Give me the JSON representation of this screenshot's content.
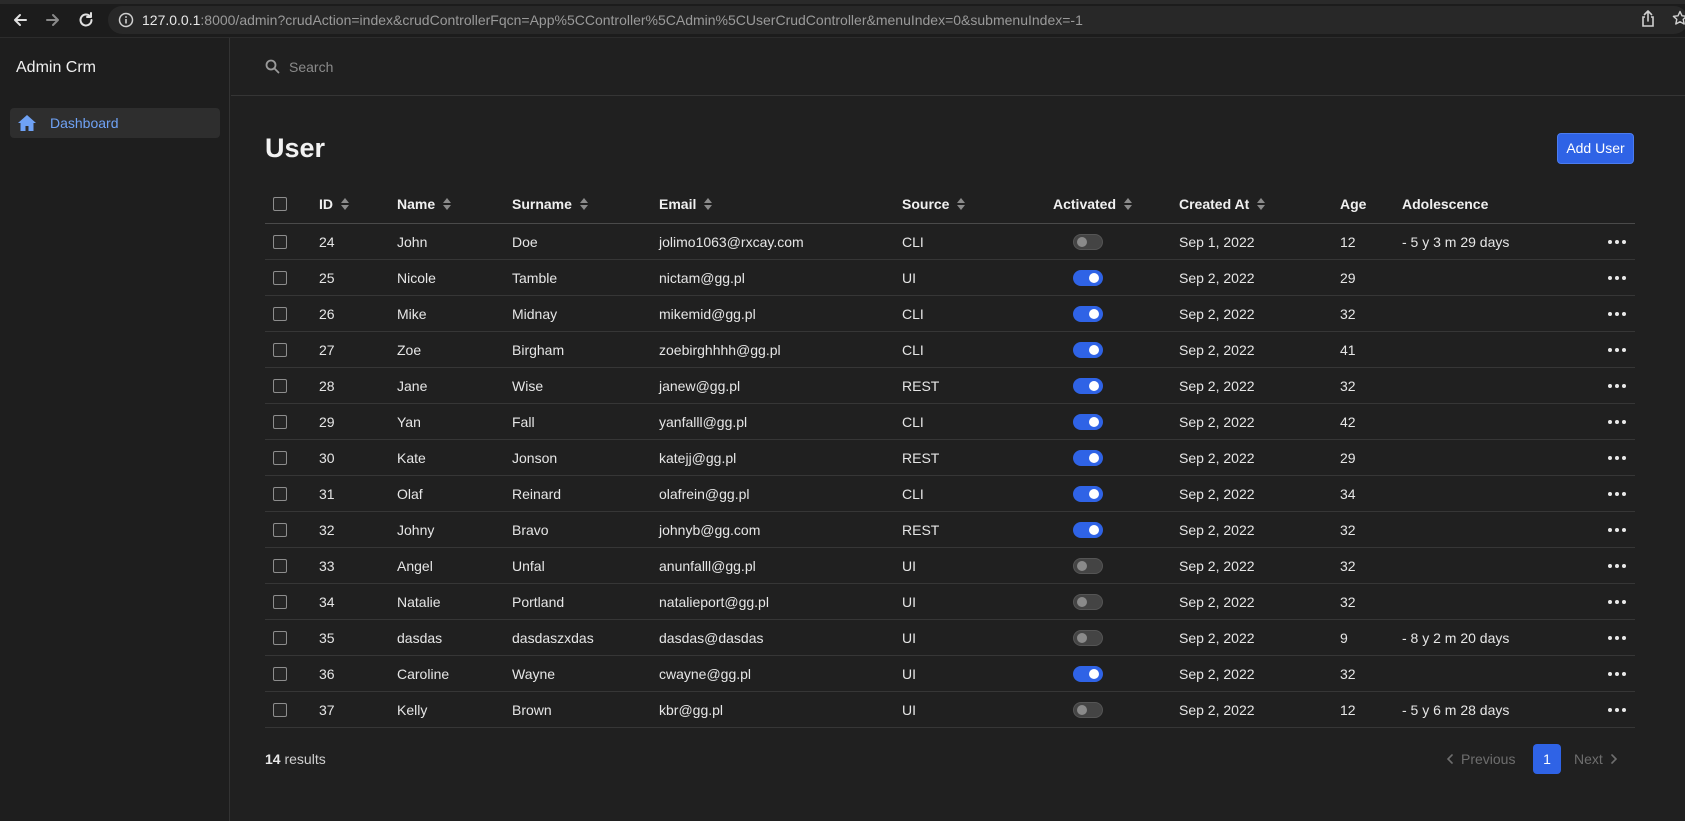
{
  "browser": {
    "url_host": "127.0.0.1",
    "url_rest": ":8000/admin?crudAction=index&crudControllerFqcn=App%5CController%5CAdmin%5CUserCrudController&menuIndex=0&submenuIndex=-1"
  },
  "sidebar": {
    "app_title": "Admin Crm",
    "items": [
      {
        "label": "Dashboard",
        "icon": "home-icon"
      }
    ]
  },
  "search": {
    "placeholder": "Search"
  },
  "page": {
    "title": "User",
    "add_button": "Add User"
  },
  "table": {
    "headers": {
      "id": "ID",
      "name": "Name",
      "surname": "Surname",
      "email": "Email",
      "source": "Source",
      "activated": "Activated",
      "created_at": "Created At",
      "age": "Age",
      "adolescence": "Adolescence"
    },
    "rows": [
      {
        "id": "24",
        "name": "John",
        "surname": "Doe",
        "email": "jolimo1063@rxcay.com",
        "source": "CLI",
        "activated": false,
        "created_at": "Sep 1, 2022",
        "age": "12",
        "adolescence": "- 5 y 3 m 29 days"
      },
      {
        "id": "25",
        "name": "Nicole",
        "surname": "Tamble",
        "email": "nictam@gg.pl",
        "source": "UI",
        "activated": true,
        "created_at": "Sep 2, 2022",
        "age": "29",
        "adolescence": ""
      },
      {
        "id": "26",
        "name": "Mike",
        "surname": "Midnay",
        "email": "mikemid@gg.pl",
        "source": "CLI",
        "activated": true,
        "created_at": "Sep 2, 2022",
        "age": "32",
        "adolescence": ""
      },
      {
        "id": "27",
        "name": "Zoe",
        "surname": "Birgham",
        "email": "zoebirghhhh@gg.pl",
        "source": "CLI",
        "activated": true,
        "created_at": "Sep 2, 2022",
        "age": "41",
        "adolescence": ""
      },
      {
        "id": "28",
        "name": "Jane",
        "surname": "Wise",
        "email": "janew@gg.pl",
        "source": "REST",
        "activated": true,
        "created_at": "Sep 2, 2022",
        "age": "32",
        "adolescence": ""
      },
      {
        "id": "29",
        "name": "Yan",
        "surname": "Fall",
        "email": "yanfalll@gg.pl",
        "source": "CLI",
        "activated": true,
        "created_at": "Sep 2, 2022",
        "age": "42",
        "adolescence": ""
      },
      {
        "id": "30",
        "name": "Kate",
        "surname": "Jonson",
        "email": "katejj@gg.pl",
        "source": "REST",
        "activated": true,
        "created_at": "Sep 2, 2022",
        "age": "29",
        "adolescence": ""
      },
      {
        "id": "31",
        "name": "Olaf",
        "surname": "Reinard",
        "email": "olafrein@gg.pl",
        "source": "CLI",
        "activated": true,
        "created_at": "Sep 2, 2022",
        "age": "34",
        "adolescence": ""
      },
      {
        "id": "32",
        "name": "Johny",
        "surname": "Bravo",
        "email": "johnyb@gg.com",
        "source": "REST",
        "activated": true,
        "created_at": "Sep 2, 2022",
        "age": "32",
        "adolescence": ""
      },
      {
        "id": "33",
        "name": "Angel",
        "surname": "Unfal",
        "email": "anunfalll@gg.pl",
        "source": "UI",
        "activated": false,
        "created_at": "Sep 2, 2022",
        "age": "32",
        "adolescence": ""
      },
      {
        "id": "34",
        "name": "Natalie",
        "surname": "Portland",
        "email": "natalieport@gg.pl",
        "source": "UI",
        "activated": false,
        "created_at": "Sep 2, 2022",
        "age": "32",
        "adolescence": ""
      },
      {
        "id": "35",
        "name": "dasdas",
        "surname": "dasdaszxdas",
        "email": "dasdas@dasdas",
        "source": "UI",
        "activated": false,
        "created_at": "Sep 2, 2022",
        "age": "9",
        "adolescence": "- 8 y 2 m 20 days"
      },
      {
        "id": "36",
        "name": "Caroline",
        "surname": "Wayne",
        "email": "cwayne@gg.pl",
        "source": "UI",
        "activated": true,
        "created_at": "Sep 2, 2022",
        "age": "32",
        "adolescence": ""
      },
      {
        "id": "37",
        "name": "Kelly",
        "surname": "Brown",
        "email": "kbr@gg.pl",
        "source": "UI",
        "activated": false,
        "created_at": "Sep 2, 2022",
        "age": "12",
        "adolescence": "- 5 y 6 m 28 days"
      }
    ]
  },
  "footer": {
    "results_count": "14",
    "results_label": "results",
    "previous": "Previous",
    "page": "1",
    "next": "Next"
  },
  "colors": {
    "accent": "#2f63e6",
    "background": "#202020",
    "sidebar_link": "#6fa2f5"
  }
}
